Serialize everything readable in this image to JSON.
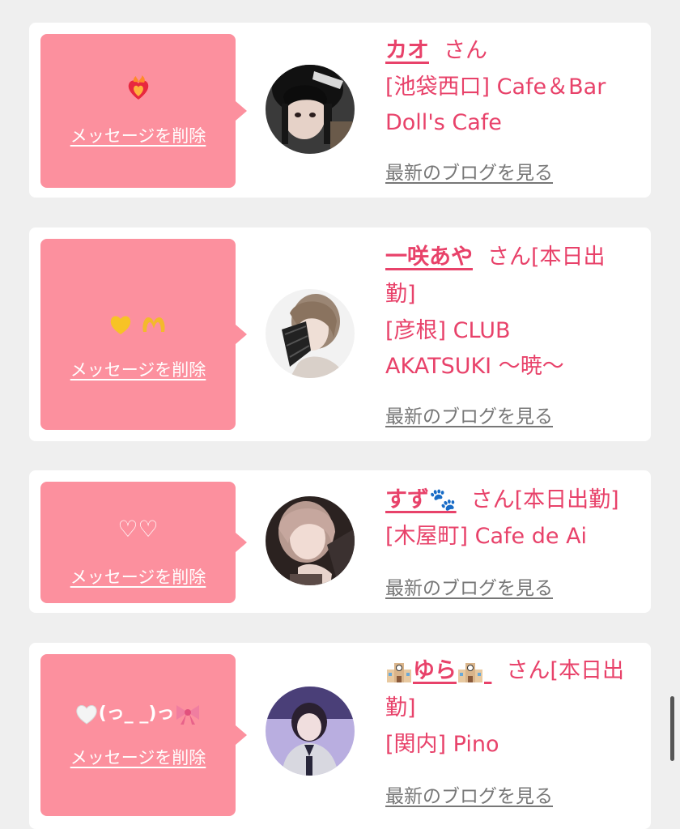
{
  "colors": {
    "accent": "#e8426a",
    "bubble": "#fc909e",
    "link_gray": "#777777"
  },
  "delete_label": "メッセージを削除",
  "blog_label": "最新のブログを見る",
  "items": [
    {
      "message_icon": "burning-heart-icon",
      "message_text": "",
      "name": "カオ",
      "suffix": "さん",
      "shop_line1": "[池袋西口] Cafe＆Bar",
      "shop_line2": "Doll's Cafe"
    },
    {
      "message_icon": "yellow-heart-and-heart-hands-icon",
      "message_text": "",
      "name": "一咲あや",
      "suffix": "さん[本日出",
      "suffix2": "勤]",
      "shop_line1": "[彦根] CLUB",
      "shop_line2": "AKATSUKI 〜暁〜"
    },
    {
      "message_icon": "",
      "message_text": "♡♡",
      "name": "すず🐾",
      "suffix": "さん[本日出勤]",
      "shop_line1": "[木屋町] Cafe de Ai"
    },
    {
      "message_icon": "white-heart-and-ribbon-icon",
      "message_text": "(っ_ _)っ",
      "name_prefix_icon": "school-icon",
      "name": "ゆら",
      "name_suffix_icon": "school-icon",
      "suffix": "さん[本日出",
      "suffix2": "勤]",
      "shop_line1": "[関内] Pino"
    }
  ]
}
